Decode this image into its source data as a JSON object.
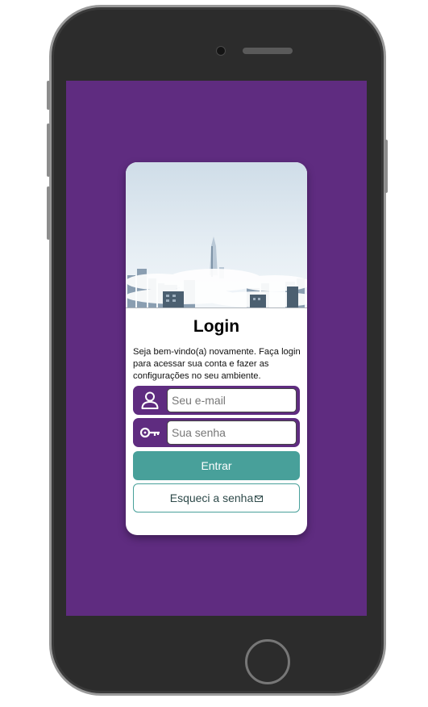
{
  "login": {
    "title": "Login",
    "description": "Seja bem-vindo(a) novamente. Faça login para acessar sua conta e fazer as configurações no seu ambiente.",
    "email_placeholder": "Seu e-mail",
    "password_placeholder": "Sua senha",
    "submit_label": "Entrar",
    "forgot_label": "Esqueci a senha"
  },
  "icons": {
    "email": "user-icon",
    "password": "key-icon",
    "forgot": "envelope-icon"
  },
  "colors": {
    "screen_background": "#5f2c80",
    "field_background": "#5f2c80",
    "primary_button": "#48a09a"
  }
}
